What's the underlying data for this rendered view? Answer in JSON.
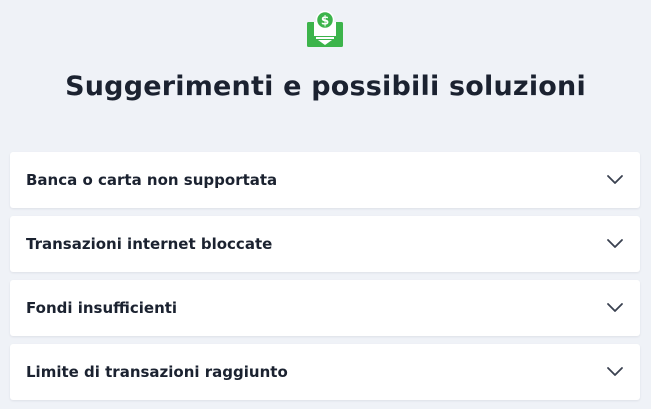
{
  "header": {
    "icon": "money-download-icon",
    "accent_color": "#3cb44b",
    "title": "Suggerimenti e possibili soluzioni"
  },
  "faq": {
    "items": [
      {
        "label": "Banca o carta non supportata",
        "icon": "chevron-down-icon"
      },
      {
        "label": "Transazioni internet bloccate",
        "icon": "chevron-down-icon"
      },
      {
        "label": "Fondi insufficienti",
        "icon": "chevron-down-icon"
      },
      {
        "label": "Limite di transazioni raggiunto",
        "icon": "chevron-down-icon"
      }
    ]
  }
}
